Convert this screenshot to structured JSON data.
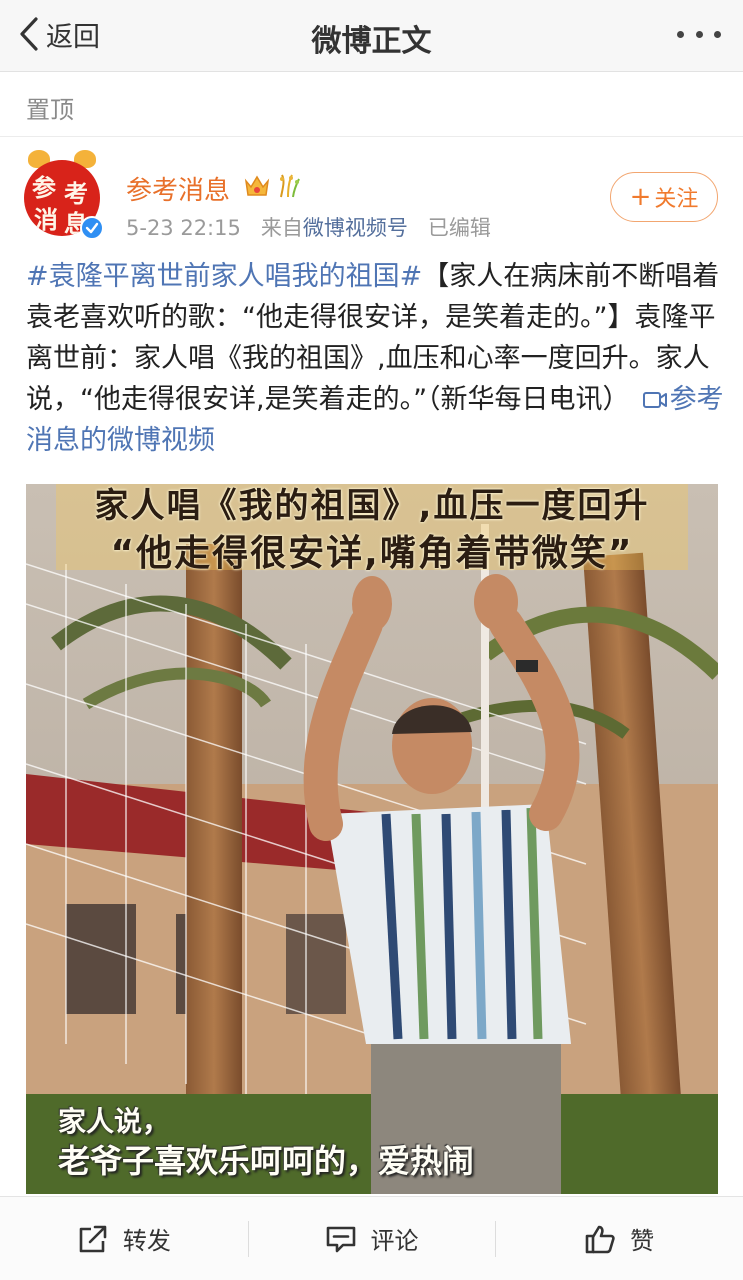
{
  "nav": {
    "back_label": "返回",
    "title": "微博正文"
  },
  "pinned_label": "置顶",
  "post": {
    "author": "参考消息",
    "avatar_text": [
      "参",
      "考",
      "消",
      "息"
    ],
    "timestamp": "5-23 22:15",
    "source_prefix": "来自",
    "source": "微博视频号",
    "edited": "已编辑",
    "follow_label": "关注",
    "hashtag": "#袁隆平离世前家人唱我的祖国#",
    "body": "【家人在病床前不断唱着袁老喜欢听的歌：“他走得很安详，是笑着走的。”】袁隆平离世前：家人唱《我的祖国》,血压和心率一度回升。家人说，“他走得很安详,是笑着走的。”（新华每日电讯）",
    "video_link": "参考消息的微博视频"
  },
  "video": {
    "caption_top_1": "家人唱《我的祖国》,血压一度回升",
    "caption_top_2": "“他走得很安详,嘴角着带微笑”",
    "subtitle_1": "家人说，",
    "subtitle_2": "老爷子喜欢乐呵呵的，爱热闹"
  },
  "actions": {
    "repost": "转发",
    "comment": "评论",
    "like": "赞"
  },
  "colors": {
    "accent_orange": "#e8702a",
    "link_blue": "#4f75b4",
    "verified_blue": "#2f8ff3"
  }
}
